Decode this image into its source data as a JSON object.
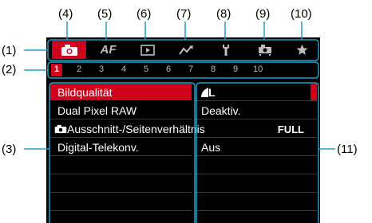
{
  "callouts": {
    "top": [
      "(4)",
      "(5)",
      "(6)",
      "(7)",
      "(8)",
      "(9)",
      "(10)"
    ],
    "left": [
      "(1)",
      "(2)",
      "(3)"
    ],
    "right": [
      "(11)"
    ]
  },
  "tabs": [
    {
      "icon": "camera-icon",
      "active": true
    },
    {
      "label": "AF",
      "icon": "af-text"
    },
    {
      "icon": "playback-icon"
    },
    {
      "icon": "wireless-icon"
    },
    {
      "icon": "wrench-icon"
    },
    {
      "icon": "custom-function-camera-icon"
    },
    {
      "icon": "star-icon"
    }
  ],
  "pages": [
    "1",
    "2",
    "3",
    "4",
    "5",
    "6",
    "7",
    "8",
    "9",
    "10"
  ],
  "menu": [
    {
      "label": "Bildqualität",
      "value": "L",
      "value_icon": "large-jpeg-quality-icon",
      "selected": true
    },
    {
      "label": "Dual Pixel RAW",
      "value": "Deaktiv."
    },
    {
      "label": "Ausschnitt-/Seitenverhältnis",
      "label_icon": "camera-icon",
      "value": "FULL"
    },
    {
      "label": "Digital-Telekonv.",
      "value": "Aus"
    }
  ],
  "colors": {
    "accent": "#d0021b",
    "background": "#000000",
    "inactive": "#bdbdbd"
  }
}
